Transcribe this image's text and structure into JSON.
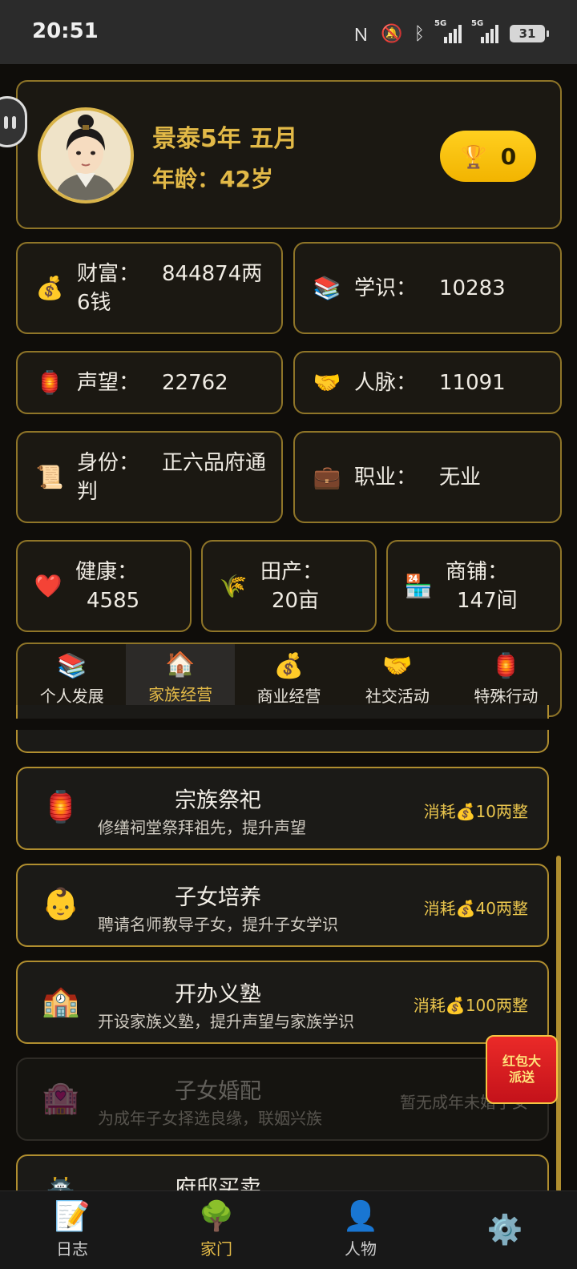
{
  "status_bar": {
    "time": "20:51",
    "battery": "31",
    "net1": "5G",
    "net2": "5G"
  },
  "profile": {
    "era": "景泰5年 五月",
    "age": "年龄：42岁",
    "trophy_count": "0"
  },
  "stats": {
    "wealth": {
      "icon": "💰",
      "label": "财富：",
      "value": "844874两6钱"
    },
    "knowledge": {
      "icon": "📚",
      "label": "学识：",
      "value": "10283"
    },
    "reputation": {
      "icon": "🏮",
      "label": "声望：",
      "value": "22762"
    },
    "connections": {
      "icon": "🤝",
      "label": "人脉：",
      "value": "11091"
    },
    "identity": {
      "icon": "📜",
      "label": "身份：",
      "value": "正六品府通判"
    },
    "occupation": {
      "icon": "💼",
      "label": "职业：",
      "value": "无业"
    },
    "health": {
      "icon": "❤️",
      "label": "健康：",
      "value": "4585"
    },
    "farmland": {
      "icon": "🌾",
      "label": "田产：",
      "value": "20亩"
    },
    "shops": {
      "icon": "🏪",
      "label": "商铺：",
      "value": "147间"
    }
  },
  "tabs": [
    {
      "icon": "📚",
      "label": "个人发展"
    },
    {
      "icon": "🏠",
      "label": "家族经营"
    },
    {
      "icon": "💰",
      "label": "商业经营"
    },
    {
      "icon": "🤝",
      "label": "社交活动"
    },
    {
      "icon": "🏮",
      "label": "特殊行动"
    }
  ],
  "actions": [
    {
      "icon": "🏮",
      "name": "宗族祭祀",
      "desc": "修缮祠堂祭拜祖先，提升声望",
      "cost": "消耗💰10两整"
    },
    {
      "icon": "👶",
      "name": "子女培养",
      "desc": "聘请名师教导子女，提升子女学识",
      "cost": "消耗💰40两整"
    },
    {
      "icon": "🏫",
      "name": "开办义塾",
      "desc": "开设家族义塾，提升声望与家族学识",
      "cost": "消耗💰100两整"
    },
    {
      "icon": "🏩",
      "name": "子女婚配",
      "desc": "为成年子女择选良缘，联姻兴族",
      "cost": "暂无成年未婚子女"
    },
    {
      "icon": "🏯",
      "name": "府邸买卖",
      "desc": "",
      "cost": ""
    }
  ],
  "red_packet": "红包大派送",
  "bottom_nav": [
    {
      "icon": "📝",
      "label": "日志"
    },
    {
      "icon": "🌳",
      "label": "家门"
    },
    {
      "icon": "👤",
      "label": "人物"
    },
    {
      "icon": "⚙️",
      "label": ""
    }
  ]
}
